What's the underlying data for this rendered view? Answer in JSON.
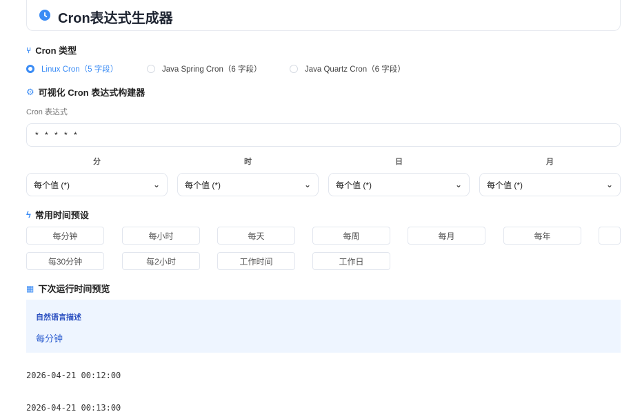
{
  "header": {
    "title": "Cron表达式生成器"
  },
  "cron_type": {
    "heading": "Cron 类型",
    "options": [
      {
        "label": "Linux Cron（5 字段）",
        "selected": true
      },
      {
        "label": "Java Spring Cron（6 字段）",
        "selected": false
      },
      {
        "label": "Java Quartz Cron（6 字段）",
        "selected": false
      }
    ]
  },
  "builder": {
    "heading": "可视化 Cron 表达式构建器",
    "expr_label": "Cron 表达式",
    "expr_value": "* * * * *",
    "fields": [
      {
        "label": "分",
        "value": "每个值 (*)"
      },
      {
        "label": "时",
        "value": "每个值 (*)"
      },
      {
        "label": "日",
        "value": "每个值 (*)"
      },
      {
        "label": "月",
        "value": "每个值 (*)"
      }
    ]
  },
  "presets": {
    "heading": "常用时间预设",
    "row1": [
      "每分钟",
      "每小时",
      "每天",
      "每周",
      "每月",
      "每年",
      ""
    ],
    "row2": [
      "每30分钟",
      "每2小时",
      "工作时间",
      "工作日"
    ]
  },
  "preview": {
    "heading": "下次运行时间预览",
    "desc_label": "自然语言描述",
    "desc_value": "每分钟",
    "times": [
      "2026-04-21 00:12:00",
      "2026-04-21 00:13:00"
    ]
  },
  "colors": {
    "accent": "#3b8cf5",
    "info_bg": "#eef5ff"
  }
}
